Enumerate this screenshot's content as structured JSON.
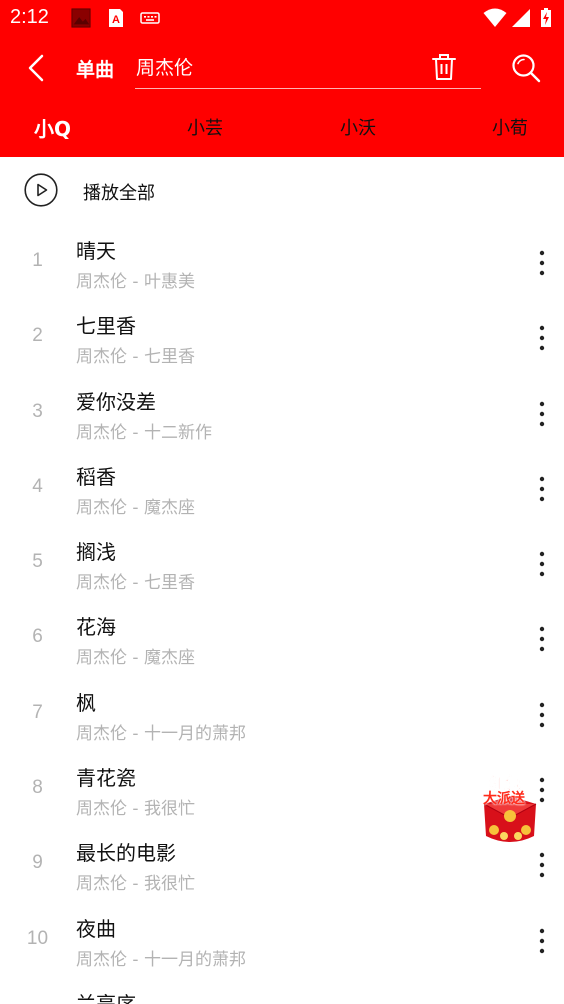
{
  "status_bar": {
    "time": "2:12",
    "icons": [
      "photo-icon",
      "notification-a-icon",
      "keyboard-icon",
      "wifi-icon",
      "signal-icon",
      "battery-icon"
    ]
  },
  "header": {
    "mode_label": "单曲",
    "search_value": "周杰伦",
    "icons": [
      "back-arrow-icon",
      "trash-icon",
      "search-icon"
    ]
  },
  "tabs": [
    {
      "label": "小Q",
      "active": true
    },
    {
      "label": "小芸",
      "active": false
    },
    {
      "label": "小沃",
      "active": false
    },
    {
      "label": "小荀",
      "active": false
    }
  ],
  "play_all": {
    "label": "播放全部",
    "icon": "play-circle-icon"
  },
  "songs": [
    {
      "num": "1",
      "title": "晴天",
      "subtitle": "周杰伦 - 叶惠美"
    },
    {
      "num": "2",
      "title": "七里香",
      "subtitle": "周杰伦 - 七里香"
    },
    {
      "num": "3",
      "title": "爱你没差",
      "subtitle": "周杰伦 - 十二新作"
    },
    {
      "num": "4",
      "title": "稻香",
      "subtitle": "周杰伦 - 魔杰座"
    },
    {
      "num": "5",
      "title": "搁浅",
      "subtitle": "周杰伦 - 七里香"
    },
    {
      "num": "6",
      "title": "花海",
      "subtitle": "周杰伦 - 魔杰座"
    },
    {
      "num": "7",
      "title": "枫",
      "subtitle": "周杰伦 - 十一月的萧邦"
    },
    {
      "num": "8",
      "title": "青花瓷",
      "subtitle": "周杰伦 - 我很忙"
    },
    {
      "num": "9",
      "title": "最长的电影",
      "subtitle": "周杰伦 - 我很忙"
    },
    {
      "num": "10",
      "title": "夜曲",
      "subtitle": "周杰伦 - 十一月的萧邦"
    },
    {
      "num": "",
      "title": "兰亭序",
      "subtitle": ""
    }
  ],
  "promo": {
    "line1": "红包",
    "line2": "大派送"
  },
  "colors": {
    "brand_red": "#ff0000",
    "muted_gray": "#b3b3b3",
    "text_dark": "#111111"
  }
}
